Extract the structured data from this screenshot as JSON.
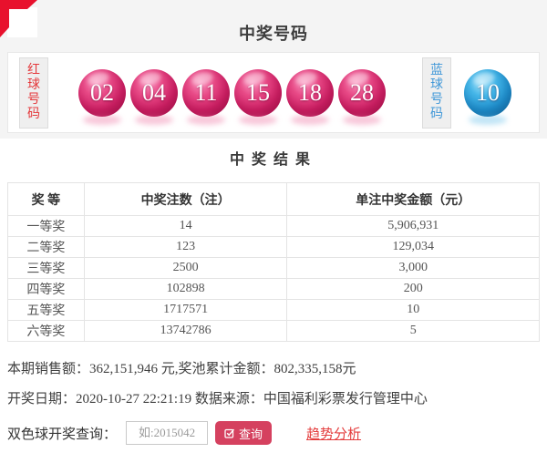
{
  "header": {
    "title": "中奖号码"
  },
  "numbers_panel": {
    "red_label": "红球号码",
    "blue_label": "蓝球号码",
    "red_balls": [
      "02",
      "04",
      "11",
      "15",
      "18",
      "28"
    ],
    "blue_balls": [
      "10"
    ]
  },
  "results": {
    "title": "中奖结果",
    "columns": [
      "奖 等",
      "中奖注数（注）",
      "单注中奖金额（元）"
    ],
    "rows": [
      {
        "level": "一等奖",
        "count": "14",
        "amount": "5,906,931"
      },
      {
        "level": "二等奖",
        "count": "123",
        "amount": "129,034"
      },
      {
        "level": "三等奖",
        "count": "2500",
        "amount": "3,000"
      },
      {
        "level": "四等奖",
        "count": "102898",
        "amount": "200"
      },
      {
        "level": "五等奖",
        "count": "1717571",
        "amount": "10"
      },
      {
        "level": "六等奖",
        "count": "13742786",
        "amount": "5"
      }
    ]
  },
  "footer": {
    "sales_text": "本期销售额：362,151,946 元,奖池累计金额：802,335,158元",
    "draw_text": "开奖日期：2020-10-27 22:21:19 数据来源：中国福利彩票发行管理中心",
    "query_label": "双色球开奖查询：",
    "query_placeholder": "如:2015042",
    "query_button_label": "查询",
    "trend_link_label": "趋势分析"
  },
  "colors": {
    "corner_ribbon_red": "#e8112d",
    "red_ball": "#d5246a",
    "blue_ball": "#2297d6",
    "red_label_text": "#e4393c",
    "blue_label_text": "#4198d8",
    "query_button_bg": "#d5415f",
    "trend_link_red": "#e43d3d",
    "section_bg": "#f4f4f4"
  }
}
